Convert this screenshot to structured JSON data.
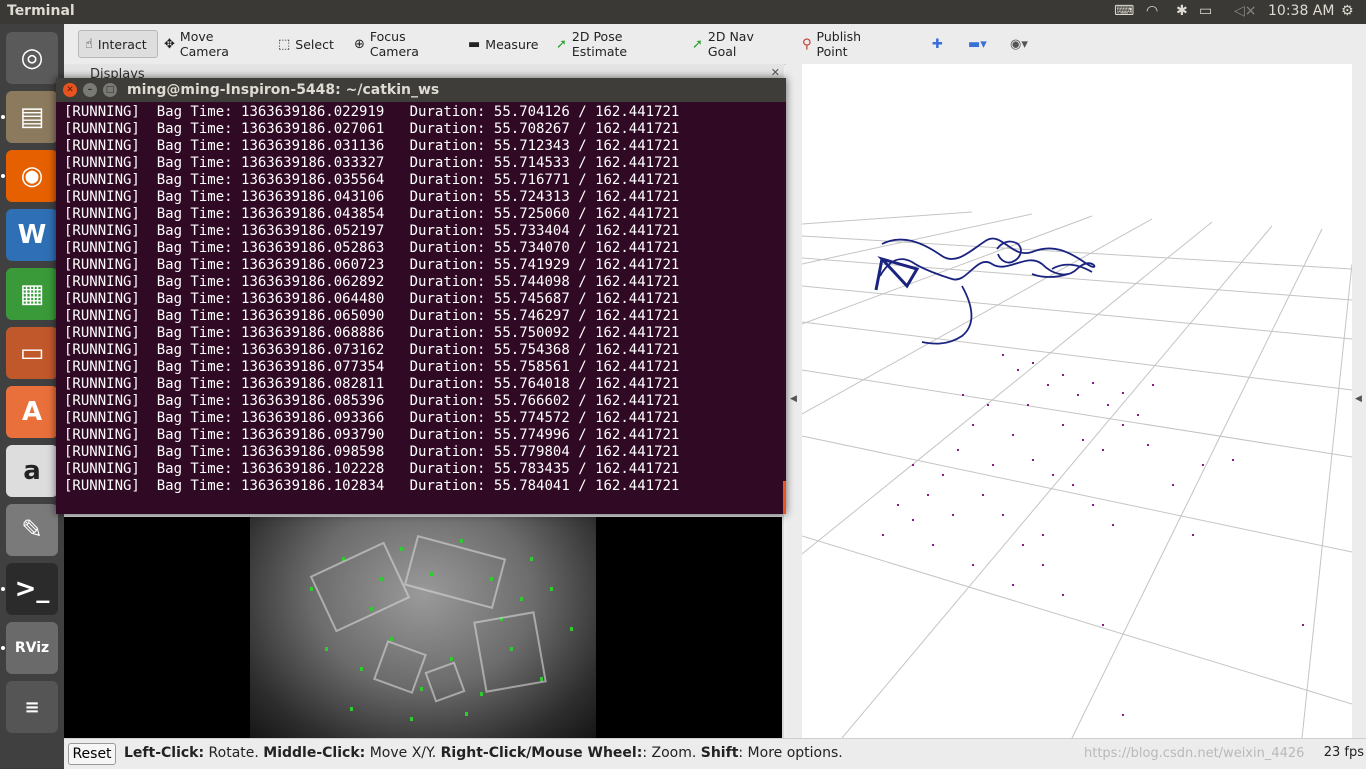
{
  "topbar": {
    "title": "Terminal",
    "clock": "10:38 AM",
    "icons": [
      "keyboard-icon",
      "wifi-icon",
      "bluetooth-icon",
      "battery-icon",
      "volume-icon",
      "power-gear-icon"
    ]
  },
  "launcher": {
    "items": [
      {
        "name": "ubuntu-dash",
        "glyph": "◎",
        "bg": "#5a5a5a"
      },
      {
        "name": "files",
        "glyph": "▤",
        "bg": "#8c7a5e"
      },
      {
        "name": "firefox",
        "glyph": "◉",
        "bg": "#e66000"
      },
      {
        "name": "writer",
        "glyph": "W",
        "bg": "#2f6fb5"
      },
      {
        "name": "calc",
        "glyph": "▦",
        "bg": "#3a9a3a"
      },
      {
        "name": "impress",
        "glyph": "▭",
        "bg": "#c0582b"
      },
      {
        "name": "software",
        "glyph": "A",
        "bg": "#e9703a"
      },
      {
        "name": "amazon",
        "glyph": "a",
        "bg": "#dddddd"
      },
      {
        "name": "settings",
        "glyph": "✎",
        "bg": "#7a7a7a"
      },
      {
        "name": "terminal",
        "glyph": ">_",
        "bg": "#2b2b2b"
      },
      {
        "name": "rviz",
        "glyph": "RViz",
        "bg": "#6a6a6a"
      }
    ]
  },
  "toolbar": {
    "tools": [
      {
        "label": "Interact",
        "icon": "hand-icon",
        "glyph": "☝",
        "active": true
      },
      {
        "label": "Move Camera",
        "icon": "move-camera-icon",
        "glyph": "✥",
        "active": false
      },
      {
        "label": "Select",
        "icon": "select-icon",
        "glyph": "⬚",
        "active": false
      },
      {
        "label": "Focus Camera",
        "icon": "focus-camera-icon",
        "glyph": "⊕",
        "active": false
      },
      {
        "label": "Measure",
        "icon": "measure-icon",
        "glyph": "▬",
        "active": false
      },
      {
        "label": "2D Pose Estimate",
        "icon": "pose-estimate-icon",
        "glyph": "➚",
        "active": false
      },
      {
        "label": "2D Nav Goal",
        "icon": "nav-goal-icon",
        "glyph": "➚",
        "active": false
      },
      {
        "label": "Publish Point",
        "icon": "map-pin-icon",
        "glyph": "⚲",
        "active": false
      }
    ],
    "accent_plus": "#3a6fd8"
  },
  "panels": {
    "displays_label": "Displays"
  },
  "statusbar": {
    "reset_label": "Reset",
    "hint_parts": [
      {
        "b": "Left-Click:",
        "t": " Rotate. "
      },
      {
        "b": "Middle-Click:",
        "t": " Move X/Y. "
      },
      {
        "b": "Right-Click/Mouse Wheel:",
        "t": ": Zoom. "
      },
      {
        "b": "Shift",
        "t": ": More options."
      }
    ],
    "watermark": "https://blog.csdn.net/weixin_4426",
    "fps": "23 fps"
  },
  "terminal": {
    "title": "ming@ming-Inspiron-5448: ~/catkin_ws",
    "status": "[RUNNING]",
    "bag_label": "Bag Time:",
    "duration_label": "Duration:",
    "total": "162.441721",
    "rows": [
      {
        "bag": "1363639186.022919",
        "dur": "55.704126"
      },
      {
        "bag": "1363639186.027061",
        "dur": "55.708267"
      },
      {
        "bag": "1363639186.031136",
        "dur": "55.712343"
      },
      {
        "bag": "1363639186.033327",
        "dur": "55.714533"
      },
      {
        "bag": "1363639186.035564",
        "dur": "55.716771"
      },
      {
        "bag": "1363639186.043106",
        "dur": "55.724313"
      },
      {
        "bag": "1363639186.043854",
        "dur": "55.725060"
      },
      {
        "bag": "1363639186.052197",
        "dur": "55.733404"
      },
      {
        "bag": "1363639186.052863",
        "dur": "55.734070"
      },
      {
        "bag": "1363639186.060723",
        "dur": "55.741929"
      },
      {
        "bag": "1363639186.062892",
        "dur": "55.744098"
      },
      {
        "bag": "1363639186.064480",
        "dur": "55.745687"
      },
      {
        "bag": "1363639186.065090",
        "dur": "55.746297"
      },
      {
        "bag": "1363639186.068886",
        "dur": "55.750092"
      },
      {
        "bag": "1363639186.073162",
        "dur": "55.754368"
      },
      {
        "bag": "1363639186.077354",
        "dur": "55.758561"
      },
      {
        "bag": "1363639186.082811",
        "dur": "55.764018"
      },
      {
        "bag": "1363639186.085396",
        "dur": "55.766602"
      },
      {
        "bag": "1363639186.093366",
        "dur": "55.774572"
      },
      {
        "bag": "1363639186.093790",
        "dur": "55.774996"
      },
      {
        "bag": "1363639186.098598",
        "dur": "55.779804"
      },
      {
        "bag": "1363639186.102228",
        "dur": "55.783435"
      },
      {
        "bag": "1363639186.102834",
        "dur": "55.784041"
      }
    ]
  }
}
